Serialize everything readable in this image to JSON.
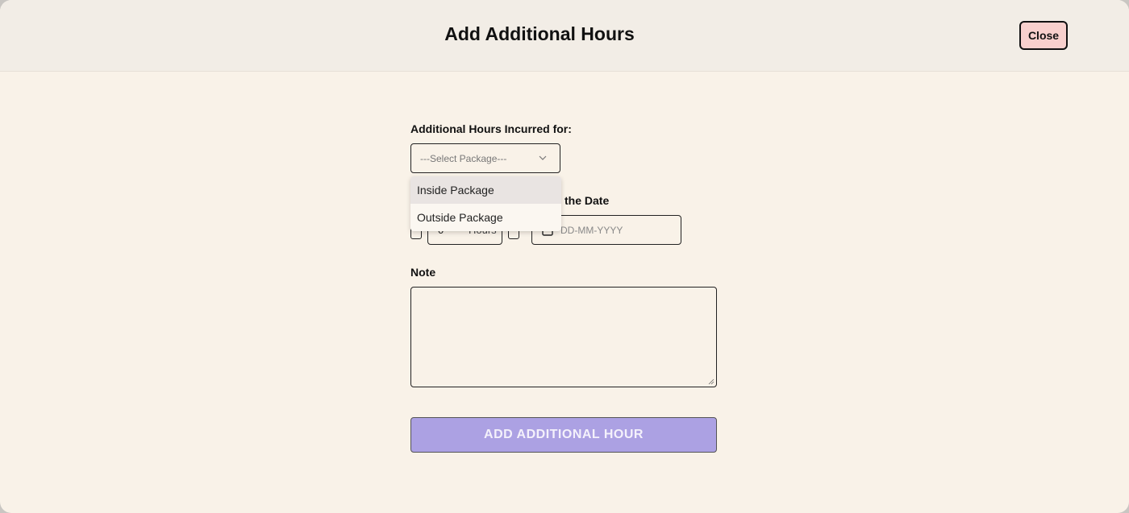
{
  "modal": {
    "title": "Add Additional Hours",
    "close_label": "Close"
  },
  "form": {
    "incurred_label": "Additional Hours Incurred for:",
    "package_select": {
      "placeholder": "---Select Package---",
      "options": [
        "Inside Package",
        "Outside Package"
      ],
      "highlighted_option": "Inside Package"
    },
    "hours": {
      "value": "0",
      "unit": "Hours"
    },
    "date_label_visible": "the Date",
    "date_placeholder": "DD-MM-YYYY",
    "note_label": "Note",
    "note_value": "",
    "submit_label": "ADD ADDITIONAL HOUR"
  },
  "colors": {
    "modal_bg": "#f9f2e8",
    "header_bg": "#f2ede6",
    "close_bg": "#f8d0cd",
    "submit_bg": "#aca1e3",
    "dropdown_highlight": "#e9e4e2"
  }
}
